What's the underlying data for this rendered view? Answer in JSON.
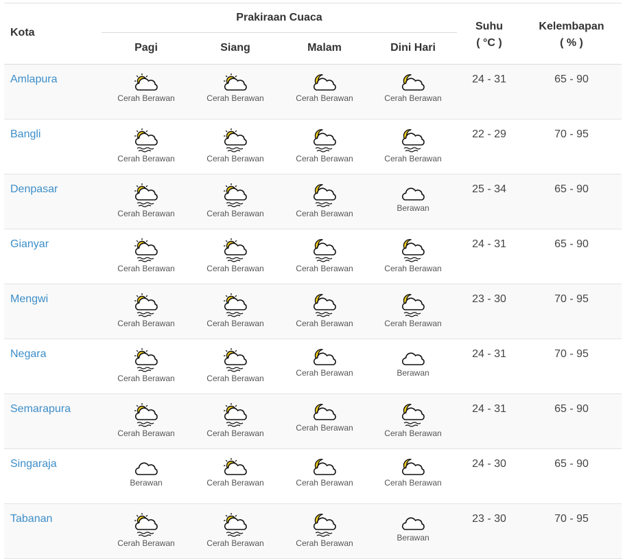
{
  "header": {
    "city": "Kota",
    "forecast_group": "Prakiraan Cuaca",
    "periods": [
      "Pagi",
      "Siang",
      "Malam",
      "Dini Hari"
    ],
    "temp": "Suhu",
    "temp_unit": "( °C )",
    "humidity": "Kelembapan",
    "humidity_unit": "( % )"
  },
  "colors": {
    "link": "#3d8ec9",
    "sun": "#f7d21a",
    "moon": "#f7d21a",
    "row_alt": "#f9f9f9"
  },
  "rows": [
    {
      "city": "Amlapura",
      "forecast": [
        {
          "icon": "sun-cloud-icon",
          "label": "Cerah Berawan"
        },
        {
          "icon": "sun-cloud-icon",
          "label": "Cerah Berawan"
        },
        {
          "icon": "moon-cloud-icon",
          "label": "Cerah Berawan"
        },
        {
          "icon": "moon-cloud-icon",
          "label": "Cerah Berawan"
        }
      ],
      "temp": "24 - 31",
      "humidity": "65 - 90"
    },
    {
      "city": "Bangli",
      "forecast": [
        {
          "icon": "sun-cloud-haze-icon",
          "label": "Cerah Berawan"
        },
        {
          "icon": "sun-cloud-haze-icon",
          "label": "Cerah Berawan"
        },
        {
          "icon": "moon-cloud-haze-icon",
          "label": "Cerah Berawan"
        },
        {
          "icon": "moon-cloud-haze-icon",
          "label": "Cerah Berawan"
        }
      ],
      "temp": "22 - 29",
      "humidity": "70 - 95"
    },
    {
      "city": "Denpasar",
      "forecast": [
        {
          "icon": "sun-cloud-haze-icon",
          "label": "Cerah Berawan"
        },
        {
          "icon": "sun-cloud-haze-icon",
          "label": "Cerah Berawan"
        },
        {
          "icon": "moon-cloud-haze-icon",
          "label": "Cerah Berawan"
        },
        {
          "icon": "cloud-icon",
          "label": "Berawan"
        }
      ],
      "temp": "25 - 34",
      "humidity": "65 - 90"
    },
    {
      "city": "Gianyar",
      "forecast": [
        {
          "icon": "sun-cloud-haze-icon",
          "label": "Cerah Berawan"
        },
        {
          "icon": "sun-cloud-haze-icon",
          "label": "Cerah Berawan"
        },
        {
          "icon": "moon-cloud-haze-icon",
          "label": "Cerah Berawan"
        },
        {
          "icon": "moon-cloud-haze-icon",
          "label": "Cerah Berawan"
        }
      ],
      "temp": "24 - 31",
      "humidity": "65 - 90"
    },
    {
      "city": "Mengwi",
      "forecast": [
        {
          "icon": "sun-cloud-haze-icon",
          "label": "Cerah Berawan"
        },
        {
          "icon": "sun-cloud-haze-icon",
          "label": "Cerah Berawan"
        },
        {
          "icon": "moon-cloud-haze-icon",
          "label": "Cerah Berawan"
        },
        {
          "icon": "moon-cloud-haze-icon",
          "label": "Cerah Berawan"
        }
      ],
      "temp": "23 - 30",
      "humidity": "70 - 95"
    },
    {
      "city": "Negara",
      "forecast": [
        {
          "icon": "sun-cloud-haze-icon",
          "label": "Cerah Berawan"
        },
        {
          "icon": "sun-cloud-haze-icon",
          "label": "Cerah Berawan"
        },
        {
          "icon": "moon-cloud-icon",
          "label": "Cerah Berawan"
        },
        {
          "icon": "cloud-icon",
          "label": "Berawan"
        }
      ],
      "temp": "24 - 31",
      "humidity": "70 - 95"
    },
    {
      "city": "Semarapura",
      "forecast": [
        {
          "icon": "sun-cloud-haze-icon",
          "label": "Cerah Berawan"
        },
        {
          "icon": "sun-cloud-haze-icon",
          "label": "Cerah Berawan"
        },
        {
          "icon": "moon-cloud-icon",
          "label": "Cerah Berawan"
        },
        {
          "icon": "moon-cloud-haze-icon",
          "label": "Cerah Berawan"
        }
      ],
      "temp": "24 - 31",
      "humidity": "65 - 90"
    },
    {
      "city": "Singaraja",
      "forecast": [
        {
          "icon": "cloud-icon",
          "label": "Berawan"
        },
        {
          "icon": "sun-cloud-icon",
          "label": "Cerah Berawan"
        },
        {
          "icon": "moon-cloud-icon",
          "label": "Cerah Berawan"
        },
        {
          "icon": "moon-cloud-icon",
          "label": "Cerah Berawan"
        }
      ],
      "temp": "24 - 30",
      "humidity": "65 - 90"
    },
    {
      "city": "Tabanan",
      "forecast": [
        {
          "icon": "sun-cloud-haze-icon",
          "label": "Cerah Berawan"
        },
        {
          "icon": "sun-cloud-haze-icon",
          "label": "Cerah Berawan"
        },
        {
          "icon": "moon-cloud-haze-icon",
          "label": "Cerah Berawan"
        },
        {
          "icon": "cloud-icon",
          "label": "Berawan"
        }
      ],
      "temp": "23 - 30",
      "humidity": "70 - 95"
    }
  ]
}
